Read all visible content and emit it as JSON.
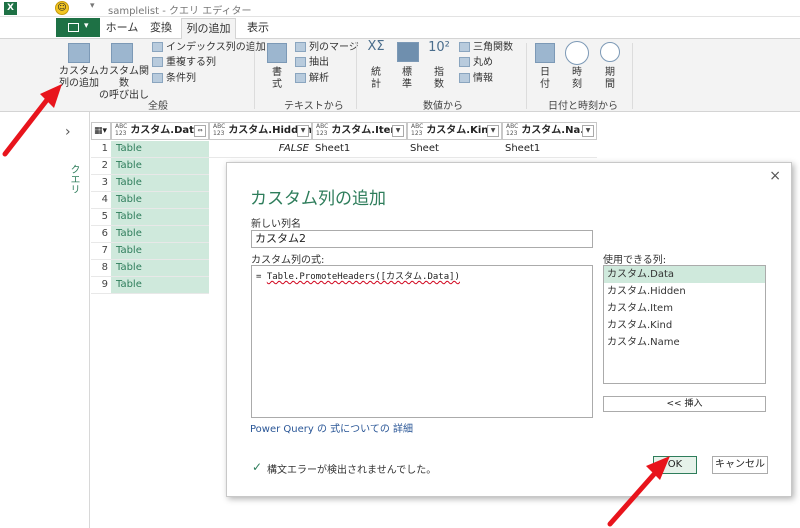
{
  "window": {
    "title": "samplelist - クエリ エディター"
  },
  "tabs": [
    "ホーム",
    "変換",
    "列の追加",
    "表示"
  ],
  "ribbon": {
    "general": {
      "custom_column_1": "カスタム",
      "custom_column_2": "列の追加",
      "custom_fn_1": "カスタム関数",
      "custom_fn_2": "の呼び出し",
      "index": "インデックス列の追加",
      "duplicate": "重複する列",
      "conditional": "条件列",
      "group": "全般"
    },
    "text": {
      "format_1": "書",
      "format_2": "式",
      "merge": "列のマージ",
      "extract": "抽出",
      "parse": "解析",
      "group": "テキストから"
    },
    "number": {
      "stats_1": "統",
      "stats_2": "計",
      "std_1": "標",
      "std_2": "準",
      "exp_1": "指",
      "exp_2": "数",
      "trig": "三角関数",
      "round": "丸め",
      "info": "情報",
      "group": "数値から"
    },
    "datetime": {
      "date_1": "日",
      "date_2": "付",
      "time_1": "時",
      "time_2": "刻",
      "dur_1": "期",
      "dur_2": "間",
      "group": "日付と時刻から"
    }
  },
  "sidebar": {
    "label": "クエリ"
  },
  "grid": {
    "headers": [
      "カスタム.Data",
      "カスタム.Hidden",
      "カスタム.Item",
      "カスタム.Kind",
      "カスタム.Na..."
    ],
    "rows": [
      {
        "n": "1",
        "data": "Table",
        "hidden": "FALSE",
        "item": "Sheet1",
        "kind": "Sheet",
        "name": "Sheet1"
      },
      {
        "n": "2",
        "data": "Table"
      },
      {
        "n": "3",
        "data": "Table"
      },
      {
        "n": "4",
        "data": "Table"
      },
      {
        "n": "5",
        "data": "Table"
      },
      {
        "n": "6",
        "data": "Table"
      },
      {
        "n": "7",
        "data": "Table"
      },
      {
        "n": "8",
        "data": "Table"
      },
      {
        "n": "9",
        "data": "Table"
      }
    ]
  },
  "dialog": {
    "title": "カスタム列の追加",
    "new_col_label": "新しい列名",
    "new_col_value": "カスタム2",
    "formula_label": "カスタム列の式:",
    "formula_prefix": "=",
    "formula_text": "Table.PromoteHeaders([カスタム.Data])",
    "available_label": "使用できる列:",
    "available": [
      "カスタム.Data",
      "カスタム.Hidden",
      "カスタム.Item",
      "カスタム.Kind",
      "カスタム.Name"
    ],
    "insert": "<< 挿入",
    "link": "Power Query の 式についての 詳細",
    "status": "構文エラーが検出されませんでした。",
    "ok": "OK",
    "cancel": "キャンセル",
    "close": "×"
  },
  "colors": {
    "accent": "#2e7d5b",
    "arrow": "#e8141c"
  }
}
